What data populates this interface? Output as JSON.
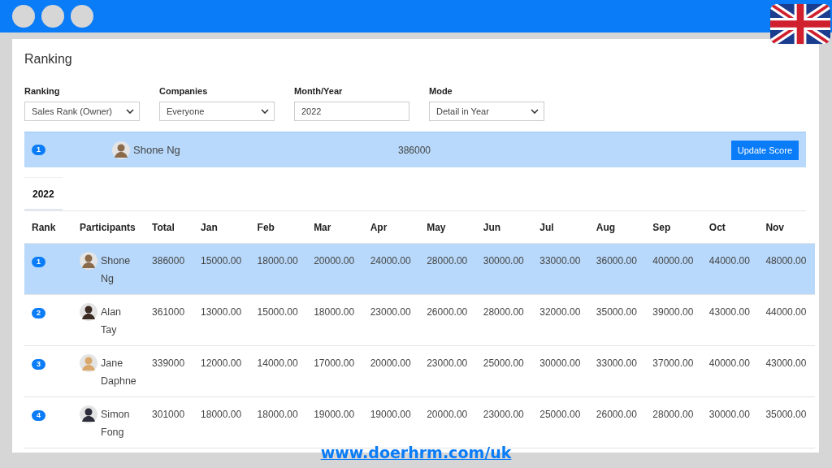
{
  "title": "Ranking",
  "filters": [
    {
      "label": "Ranking",
      "kind": "select",
      "value": "Sales Rank (Owner)"
    },
    {
      "label": "Companies",
      "kind": "select",
      "value": "Everyone"
    },
    {
      "label": "Month/Year",
      "kind": "input",
      "value": "2022"
    },
    {
      "label": "Mode",
      "kind": "select",
      "value": "Detail in Year"
    }
  ],
  "leader": {
    "rank": "1",
    "name": "Shone Ng",
    "total": "386000",
    "button": "Update Score"
  },
  "tabs": [
    {
      "label": "2022",
      "selected": true
    }
  ],
  "table": {
    "columns": [
      "Rank",
      "Participants",
      "Total",
      "Jan",
      "Feb",
      "Mar",
      "Apr",
      "May",
      "Jun",
      "Jul",
      "Aug",
      "Sep",
      "Oct",
      "Nov"
    ],
    "rows": [
      {
        "rank": "1",
        "name": "Shone Ng",
        "total": "386000",
        "selected": true,
        "months": [
          "15000.00",
          "18000.00",
          "20000.00",
          "24000.00",
          "28000.00",
          "30000.00",
          "33000.00",
          "36000.00",
          "40000.00",
          "44000.00",
          "48000.00"
        ]
      },
      {
        "rank": "2",
        "name": "Alan Tay",
        "total": "361000",
        "selected": false,
        "months": [
          "13000.00",
          "15000.00",
          "18000.00",
          "23000.00",
          "26000.00",
          "28000.00",
          "32000.00",
          "35000.00",
          "39000.00",
          "43000.00",
          "44000.00"
        ]
      },
      {
        "rank": "3",
        "name": "Jane Daphne",
        "total": "339000",
        "selected": false,
        "months": [
          "12000.00",
          "14000.00",
          "17000.00",
          "20000.00",
          "23000.00",
          "25000.00",
          "30000.00",
          "33000.00",
          "37000.00",
          "40000.00",
          "43000.00"
        ]
      },
      {
        "rank": "4",
        "name": "Simon Fong",
        "total": "301000",
        "selected": false,
        "months": [
          "18000.00",
          "18000.00",
          "19000.00",
          "19000.00",
          "20000.00",
          "23000.00",
          "25000.00",
          "26000.00",
          "28000.00",
          "30000.00",
          "35000.00"
        ]
      }
    ]
  },
  "link": "www.doerhrm.com/uk"
}
